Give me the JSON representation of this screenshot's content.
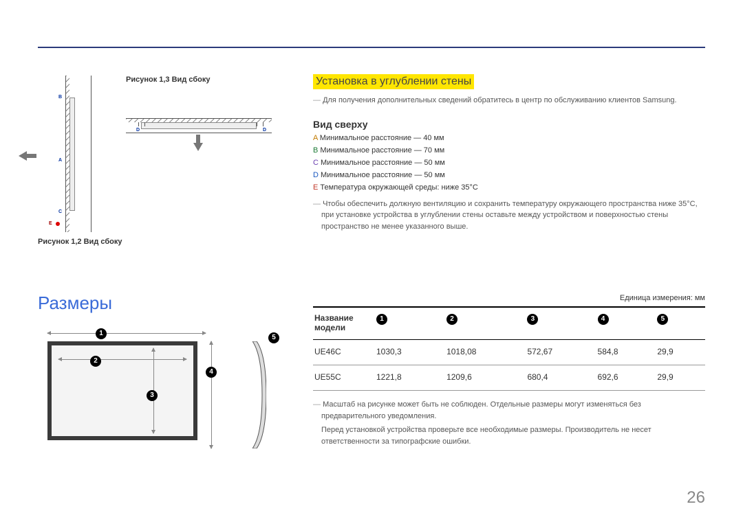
{
  "figures": {
    "fig13_caption": "Рисунок 1,3 Вид сбоку",
    "fig12_caption": "Рисунок 1,2 Вид сбоку",
    "labels": {
      "A": "A",
      "B": "B",
      "C": "C",
      "D": "D",
      "E": "E"
    }
  },
  "wall_section": {
    "heading": "Установка в углублении стены",
    "note": "Для получения дополнительных сведений обратитесь в центр по обслуживанию клиентов Samsung.",
    "subhead": "Вид сверху",
    "specs": {
      "A": "Минимальное расстояние — 40 мм",
      "B": "Минимальное расстояние — 70 мм",
      "C": "Минимальное расстояние — 50 мм",
      "D": "Минимальное расстояние — 50 мм",
      "E": "Температура окружающей среды: ниже 35°C"
    },
    "long_note": "Чтобы обеспечить должную вентиляцию и сохранить температуру окружающего пространства ниже 35°C, при установке устройства в углублении стены оставьте между устройством и поверхностью стены пространство не менее указанного выше."
  },
  "dimensions": {
    "heading": "Размеры",
    "markers": {
      "1": "1",
      "2": "2",
      "3": "3",
      "4": "4",
      "5": "5"
    }
  },
  "table": {
    "unit_note": "Единица измерения: мм",
    "header": "Название модели",
    "rows": [
      {
        "model": "UE46C",
        "c1": "1030,3",
        "c2": "1018,08",
        "c3": "572,67",
        "c4": "584,8",
        "c5": "29,9"
      },
      {
        "model": "UE55C",
        "c1": "1221,8",
        "c2": "1209,6",
        "c3": "680,4",
        "c4": "692,6",
        "c5": "29,9"
      }
    ],
    "footnote1": "Масштаб на рисунке может быть не соблюден. Отдельные размеры могут изменяться без предварительного уведомления.",
    "footnote2": "Перед установкой устройства проверьте все необходимые размеры. Производитель не несет ответственности за типографские ошибки."
  },
  "page_number": "26"
}
